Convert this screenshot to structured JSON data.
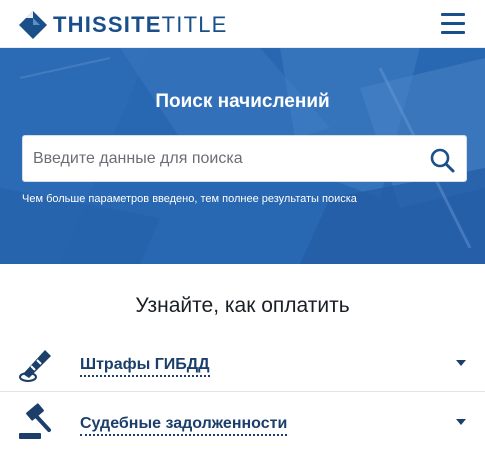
{
  "header": {
    "logo_bold": "THIS",
    "logo_mid": "SITE",
    "logo_thin": "TITLE",
    "menu_icon": "hamburger-icon"
  },
  "hero": {
    "title": "Поиск начислений",
    "search_placeholder": "Введите данные для поиска",
    "search_icon": "search-icon",
    "hint": "Чем больше параметров введено, тем полнее результаты поиска"
  },
  "payment": {
    "title": "Узнайте, как оплатить",
    "items": [
      {
        "label": "Штрафы ГИБДД",
        "icon": "baton-icon"
      },
      {
        "label": "Судебные задолженности",
        "icon": "gavel-icon"
      }
    ]
  },
  "colors": {
    "brand": "#1b4f8a",
    "hero_bg": "#3b7ec6",
    "link": "#1b3f6a"
  }
}
